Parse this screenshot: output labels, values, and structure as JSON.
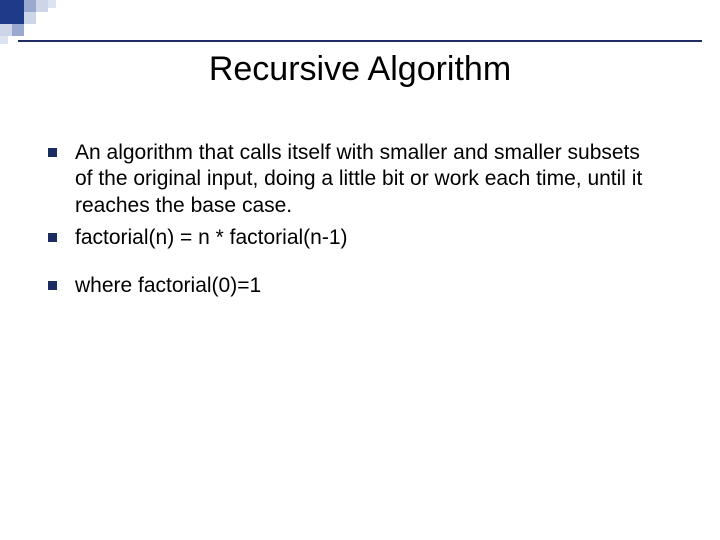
{
  "title": "Recursive Algorithm",
  "bullets": [
    {
      "text": "An algorithm that calls itself with smaller and smaller subsets of the original input, doing a little bit or work each time, until it reaches the base case."
    },
    {
      "text": "factorial(n) = n * factorial(n-1)"
    },
    {
      "text": "where factorial(0)=1"
    }
  ]
}
